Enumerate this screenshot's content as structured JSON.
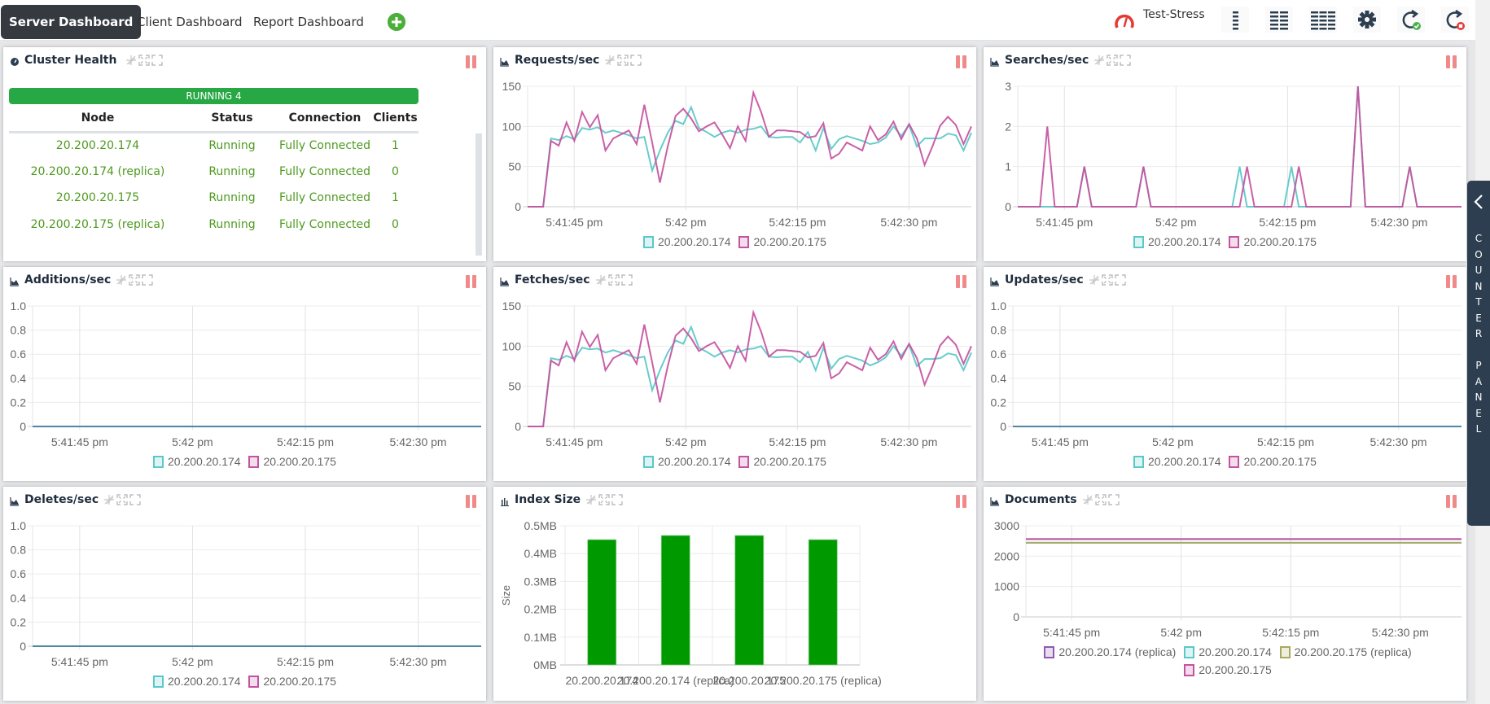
{
  "topbar": {
    "tabs": [
      {
        "label": "Server Dashboard",
        "active": true
      },
      {
        "label": "Client Dashboard",
        "active": false
      },
      {
        "label": "Report Dashboard",
        "active": false
      }
    ],
    "add_tab_icon": "plus-circle-icon",
    "profile_icon": "speedometer-icon",
    "profile_name": "Test-Stress",
    "toolbar_icons": [
      "layout-1-column-icon",
      "layout-2-columns-icon",
      "layout-3-columns-icon",
      "settings-gear-icon",
      "refresh-start-icon",
      "refresh-stop-icon"
    ]
  },
  "counter_panel": {
    "label": "COUNTER PANEL",
    "letters": [
      "C",
      "O",
      "U",
      "N",
      "T",
      "E",
      "R",
      " ",
      "P",
      "A",
      "N",
      "E",
      "L"
    ],
    "icon": "chevron-left-icon"
  },
  "colors": {
    "teal": "#5bc8c8",
    "magenta": "#c4539f",
    "overlap": "#4f84a3",
    "purple": "#8e5bb0",
    "olive": "#a8a860",
    "green_bar": "#009900",
    "running": "#28a745",
    "status_text": "#4e9a1e",
    "pause": "#f08a8a"
  },
  "cluster_health": {
    "title": "Cluster Health",
    "running_label": "RUNNING 4",
    "columns": [
      "Node",
      "Status",
      "Connection",
      "Clients"
    ],
    "rows": [
      {
        "node": "20.200.20.174",
        "status": "Running",
        "connection": "Fully Connected",
        "clients": "1"
      },
      {
        "node": "20.200.20.174 (replica)",
        "status": "Running",
        "connection": "Fully Connected",
        "clients": "0"
      },
      {
        "node": "20.200.20.175",
        "status": "Running",
        "connection": "Fully Connected",
        "clients": "1"
      },
      {
        "node": "20.200.20.175 (replica)",
        "status": "Running",
        "connection": "Fully Connected",
        "clients": "0"
      }
    ]
  },
  "panels": {
    "requests": {
      "title": "Requests/sec"
    },
    "searches": {
      "title": "Searches/sec"
    },
    "additions": {
      "title": "Additions/sec"
    },
    "fetches": {
      "title": "Fetches/sec"
    },
    "updates": {
      "title": "Updates/sec"
    },
    "deletes": {
      "title": "Deletes/sec"
    },
    "index_size": {
      "title": "Index Size"
    },
    "documents": {
      "title": "Documents"
    }
  },
  "chart_data": [
    {
      "id": "requests",
      "type": "line",
      "title": "Requests/sec",
      "x_ticks": [
        "5:41:45 pm",
        "5:42 pm",
        "5:42:15 pm",
        "5:42:30 pm"
      ],
      "y_ticks": [
        "0",
        "50",
        "100",
        "150"
      ],
      "ylim": [
        0,
        150
      ],
      "grid": true,
      "legend": "bottom",
      "series": [
        {
          "name": "20.200.20.174",
          "color": "teal",
          "values": [
            0,
            0,
            0,
            85,
            83,
            88,
            84,
            98,
            96,
            99,
            92,
            95,
            92,
            89,
            85,
            87,
            45,
            70,
            92,
            107,
            103,
            124,
            98,
            93,
            87,
            92,
            95,
            92,
            96,
            97,
            100,
            87,
            86,
            87,
            87,
            80,
            93,
            70,
            98,
            72,
            84,
            88,
            85,
            82,
            78,
            80,
            86,
            100,
            88,
            102,
            75,
            85,
            85,
            85,
            91,
            89,
            70,
            92
          ]
        },
        {
          "name": "20.200.20.175",
          "color": "magenta",
          "values": [
            0,
            0,
            0,
            82,
            76,
            105,
            82,
            118,
            99,
            114,
            70,
            85,
            90,
            95,
            78,
            127,
            80,
            30,
            75,
            113,
            122,
            110,
            94,
            100,
            105,
            90,
            73,
            100,
            82,
            142,
            118,
            87,
            95,
            95,
            94,
            93,
            86,
            88,
            104,
            60,
            66,
            80,
            75,
            70,
            100,
            83,
            90,
            106,
            84,
            103,
            85,
            52,
            75,
            101,
            112,
            102,
            78,
            100
          ]
        }
      ]
    },
    {
      "id": "searches",
      "type": "line",
      "title": "Searches/sec",
      "x_ticks": [
        "5:41:45 pm",
        "5:42 pm",
        "5:42:15 pm",
        "5:42:30 pm"
      ],
      "y_ticks": [
        "0",
        "1",
        "2",
        "3"
      ],
      "ylim": [
        0,
        3
      ],
      "grid": true,
      "legend": "bottom",
      "series": [
        {
          "name": "20.200.20.174",
          "color": "teal",
          "values": [
            0,
            0,
            0,
            0,
            0,
            0,
            0,
            0,
            0,
            1,
            0,
            0,
            0,
            0,
            0,
            0,
            0,
            1,
            0,
            0,
            0,
            0,
            0,
            0,
            0,
            0,
            0,
            0,
            0,
            0,
            1,
            0,
            0,
            0,
            0,
            0,
            0,
            1,
            0,
            0,
            0,
            0,
            0,
            0,
            0,
            0,
            3,
            0,
            0,
            0,
            0,
            0,
            0,
            1,
            0,
            0,
            0,
            0,
            0,
            0,
            0
          ]
        },
        {
          "name": "20.200.20.175",
          "color": "magenta",
          "values": [
            0,
            0,
            0,
            0,
            2,
            0,
            0,
            0,
            0,
            1,
            0,
            0,
            0,
            0,
            0,
            0,
            0,
            1,
            0,
            0,
            0,
            0,
            0,
            0,
            0,
            0,
            0,
            0,
            0,
            0,
            0,
            1,
            0,
            0,
            0,
            0,
            0,
            0,
            1,
            0,
            0,
            0,
            0,
            0,
            0,
            0,
            3,
            0,
            0,
            0,
            0,
            0,
            0,
            1,
            0,
            0,
            0,
            0,
            0,
            0,
            0
          ]
        }
      ]
    },
    {
      "id": "additions",
      "type": "line",
      "title": "Additions/sec",
      "x_ticks": [
        "5:41:45 pm",
        "5:42 pm",
        "5:42:15 pm",
        "5:42:30 pm"
      ],
      "y_ticks": [
        "0",
        "0.2",
        "0.4",
        "0.6",
        "0.8",
        "1.0"
      ],
      "ylim": [
        0,
        1
      ],
      "grid": true,
      "legend": "bottom",
      "series": [
        {
          "name": "20.200.20.174",
          "color": "teal",
          "values": [
            0,
            0
          ]
        },
        {
          "name": "20.200.20.175",
          "color": "magenta",
          "values": [
            0,
            0
          ]
        }
      ]
    },
    {
      "id": "fetches",
      "type": "line",
      "title": "Fetches/sec",
      "x_ticks": [
        "5:41:45 pm",
        "5:42 pm",
        "5:42:15 pm",
        "5:42:30 pm"
      ],
      "y_ticks": [
        "0",
        "50",
        "100",
        "150"
      ],
      "ylim": [
        0,
        150
      ],
      "grid": true,
      "legend": "bottom",
      "series": [
        {
          "name": "20.200.20.174",
          "color": "teal",
          "values": [
            0,
            0,
            0,
            85,
            83,
            88,
            84,
            98,
            96,
            97,
            92,
            95,
            92,
            89,
            85,
            87,
            45,
            70,
            92,
            107,
            103,
            124,
            98,
            93,
            87,
            92,
            95,
            92,
            96,
            97,
            100,
            87,
            86,
            87,
            87,
            80,
            93,
            70,
            98,
            72,
            84,
            88,
            85,
            82,
            76,
            80,
            86,
            100,
            88,
            102,
            75,
            84,
            84,
            85,
            91,
            89,
            70,
            92
          ]
        },
        {
          "name": "20.200.20.175",
          "color": "magenta",
          "values": [
            0,
            0,
            0,
            82,
            76,
            105,
            82,
            118,
            99,
            114,
            70,
            85,
            90,
            95,
            78,
            127,
            80,
            30,
            75,
            113,
            122,
            110,
            94,
            100,
            105,
            90,
            73,
            100,
            82,
            142,
            118,
            87,
            95,
            95,
            94,
            93,
            86,
            88,
            104,
            60,
            66,
            80,
            75,
            70,
            98,
            83,
            90,
            106,
            84,
            103,
            85,
            52,
            75,
            101,
            112,
            102,
            78,
            100
          ]
        }
      ]
    },
    {
      "id": "updates",
      "type": "line",
      "title": "Updates/sec",
      "x_ticks": [
        "5:41:45 pm",
        "5:42 pm",
        "5:42:15 pm",
        "5:42:30 pm"
      ],
      "y_ticks": [
        "0",
        "0.2",
        "0.4",
        "0.6",
        "0.8",
        "1.0"
      ],
      "ylim": [
        0,
        1
      ],
      "grid": true,
      "legend": "bottom",
      "series": [
        {
          "name": "20.200.20.174",
          "color": "teal",
          "values": [
            0,
            0
          ]
        },
        {
          "name": "20.200.20.175",
          "color": "magenta",
          "values": [
            0,
            0
          ]
        }
      ]
    },
    {
      "id": "deletes",
      "type": "line",
      "title": "Deletes/sec",
      "x_ticks": [
        "5:41:45 pm",
        "5:42 pm",
        "5:42:15 pm",
        "5:42:30 pm"
      ],
      "y_ticks": [
        "0",
        "0.2",
        "0.4",
        "0.6",
        "0.8",
        "1.0"
      ],
      "ylim": [
        0,
        1
      ],
      "grid": true,
      "legend": "bottom",
      "series": [
        {
          "name": "20.200.20.174",
          "color": "teal",
          "values": [
            0,
            0
          ]
        },
        {
          "name": "20.200.20.175",
          "color": "magenta",
          "values": [
            0,
            0
          ]
        }
      ]
    },
    {
      "id": "index_size",
      "type": "bar",
      "title": "Index Size",
      "ylabel": "Size",
      "categories": [
        "20.200.20.174",
        "20.200.20.174 (replica)",
        "20.200.20.175",
        "20.200.20.175 (replica)"
      ],
      "values": [
        0.45,
        0.465,
        0.465,
        0.45
      ],
      "unit": "MB",
      "y_ticks": [
        "0MB",
        "0.1MB",
        "0.2MB",
        "0.3MB",
        "0.4MB",
        "0.5MB"
      ],
      "ylim": [
        0,
        0.5
      ],
      "grid": true,
      "color": "green_bar"
    },
    {
      "id": "documents",
      "type": "line",
      "title": "Documents",
      "x_ticks": [
        "5:41:45 pm",
        "5:42 pm",
        "5:42:15 pm",
        "5:42:30 pm"
      ],
      "y_ticks": [
        "0",
        "1000",
        "2000",
        "3000"
      ],
      "ylim": [
        0,
        3000
      ],
      "grid": true,
      "legend": "bottom",
      "series": [
        {
          "name": "20.200.20.174 (replica)",
          "color": "purple",
          "values": [
            2560,
            2560
          ]
        },
        {
          "name": "20.200.20.174",
          "color": "teal",
          "values": [
            2440,
            2440
          ]
        },
        {
          "name": "20.200.20.175 (replica)",
          "color": "olive",
          "values": [
            2440,
            2440
          ]
        },
        {
          "name": "20.200.20.175",
          "color": "magenta",
          "values": [
            2560,
            2560
          ]
        }
      ]
    }
  ]
}
